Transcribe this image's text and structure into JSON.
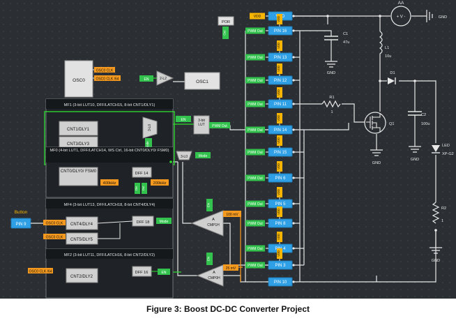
{
  "caption": "Figure 3: Boost DC-DC Converter Project",
  "colors": {
    "canvas_bg": "#2b2f33",
    "grid_dot": "#3f454b",
    "wire_green": "#2ee02e",
    "wire_white": "#e8e8e8",
    "wire_orange": "#ff9a1a",
    "pin_blue": "#2fa0e6",
    "label_green": "#33c24d",
    "label_orange": "#f59a1e",
    "vdd_orange": "#f7b500",
    "block_gray": "#d0d0d0",
    "panel_dark": "#1f2226",
    "panel_header": "#15181b"
  },
  "macrocells": {
    "mf1": {
      "header": "MF1 (3-bit LUT10, DFF/LATCH15, 8-bit CNT1/DLY1)",
      "cnt1": "CNT1/DLY1",
      "cnt3": "CNT3/DLY3",
      "lut": "3-L0",
      "mode_tag": "Mode"
    },
    "mf0": {
      "header": "MF0 (4-bit LUT1, DFF/LATCH14, WS Ctrl, 16-bit CNT0/DLY0/ FSM0)",
      "cnt0": "CNT0/DLY0/ FSM0",
      "dff": "DFF 14",
      "freq_left": "400kHz",
      "freq_right": "200kHz",
      "pin_tags": [
        "Div",
        "Out",
        "Out"
      ]
    },
    "mf4": {
      "header": "MF4 (3-bit LUT13, DFF/LATCH18, 8-bit CNT4/DLY4)",
      "cnt4": "CNT4/DLY4",
      "cnt5": "CNT5/DLY5",
      "dff": "DFF 18",
      "mode_tag": "Mode"
    },
    "mf2": {
      "header": "MF2 (3-bit LUT11, DFF/LATCH16, 8-bit CNT2/DLY2)",
      "cnt2": "CNT2/DLY2",
      "dff": "DFF 16",
      "en_tag": "EN"
    }
  },
  "blocks": {
    "osc0": {
      "name": "OSC0",
      "outputs": [
        "OSC0 CLK",
        "OSC0 CLK /64"
      ]
    },
    "osc1": {
      "name": "OSC1",
      "buffer": "2-L2",
      "en_tag": "EN"
    },
    "por": {
      "name": "POR",
      "tag": "Out"
    },
    "lut_top": {
      "name": "3-bit LUT",
      "en_tag": "EN",
      "out_tag": "PWM Out"
    },
    "lut_3l0": {
      "name": "3-L0",
      "mode_tag": "Mode"
    },
    "cmp1h": {
      "name": "CMP1H",
      "plus": "A",
      "en_tag": "EN",
      "ref": "100 mV"
    },
    "cmp0h": {
      "name": "CMP0H",
      "plus": "A",
      "en_tag": "EN",
      "ref": "25 mV"
    },
    "button": {
      "label": "Button",
      "pin": "PIN 9",
      "tags": [
        "OSC0 CLK",
        "OSC0 CLK"
      ],
      "clk64": "OSC0 CLK /64"
    }
  },
  "pins": [
    {
      "name": "VDD",
      "tag": "VDD"
    },
    {
      "name": "PIN 16",
      "tag": "PWM Out"
    },
    {
      "name": "PIN 13",
      "tag": "PWM Out"
    },
    {
      "name": "PIN 12",
      "tag": "PWM Out"
    },
    {
      "name": "PIN 11",
      "tag": "PWM Out"
    },
    {
      "name": "PIN 14",
      "tag": "PWM Out"
    },
    {
      "name": "PIN 15",
      "tag": "PWM Out"
    },
    {
      "name": "PIN 6",
      "tag": "PWM Out"
    },
    {
      "name": "PIN 5",
      "tag": "PWM Out"
    },
    {
      "name": "PIN 8",
      "tag": "PWM Out"
    },
    {
      "name": "PIN 4",
      "tag": "PWM Out"
    },
    {
      "name": "PIN 3",
      "tag": "PWM Out"
    },
    {
      "name": "PIN 10",
      "tag": ""
    }
  ],
  "vdd_tag": "VDD",
  "components": {
    "battery": {
      "name": "AA",
      "symbol": "+ V -"
    },
    "gnd_label": "GND",
    "c1": {
      "name": "C1",
      "value": "47u"
    },
    "l1": {
      "name": "L1",
      "value": "10u"
    },
    "d1": {
      "name": "D1"
    },
    "r1": {
      "name": "R1",
      "value": "1"
    },
    "q1": {
      "name": "Q1"
    },
    "c2": {
      "name": "C2",
      "value": "100u"
    },
    "led": {
      "name": "LED",
      "value": "XP-G2"
    },
    "r2": {
      "name": "R2",
      "value": "1"
    }
  }
}
